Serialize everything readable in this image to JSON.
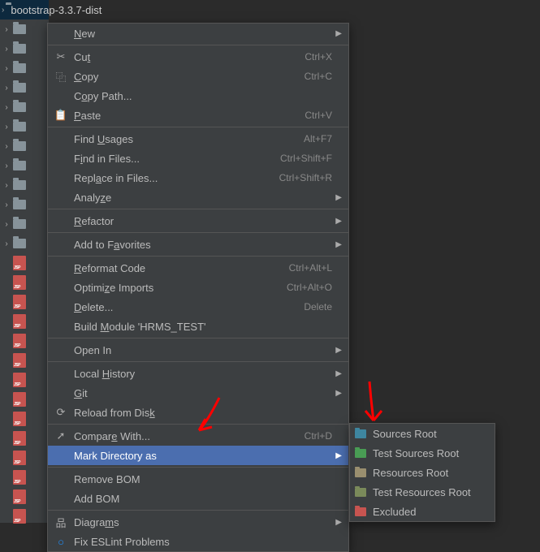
{
  "tree": {
    "selected_folder": "bootstrap-3.3.7-dist",
    "folder_rows": 12,
    "jsp_rows": 14
  },
  "context_menu": {
    "groups": [
      [
        {
          "id": "new",
          "label_html": "<span class='mn'>N</span>ew",
          "icon": "",
          "submenu": true
        }
      ],
      [
        {
          "id": "cut",
          "label_html": "Cu<span class='mn'>t</span>",
          "icon": "scissors",
          "shortcut": "Ctrl+X"
        },
        {
          "id": "copy",
          "label_html": "<span class='mn'>C</span>opy",
          "icon": "copy",
          "shortcut": "Ctrl+C"
        },
        {
          "id": "copypath",
          "label_html": "C<span class='mn'>o</span>py Path...",
          "icon": ""
        },
        {
          "id": "paste",
          "label_html": "<span class='mn'>P</span>aste",
          "icon": "clipboard",
          "shortcut": "Ctrl+V"
        }
      ],
      [
        {
          "id": "findusages",
          "label_html": "Find <span class='mn'>U</span>sages",
          "icon": "",
          "shortcut": "Alt+F7"
        },
        {
          "id": "findinfiles",
          "label_html": "F<span class='mn'>i</span>nd in Files...",
          "icon": "",
          "shortcut": "Ctrl+Shift+F"
        },
        {
          "id": "replaceinfiles",
          "label_html": "Repl<span class='mn'>a</span>ce in Files...",
          "icon": "",
          "shortcut": "Ctrl+Shift+R"
        },
        {
          "id": "analyze",
          "label_html": "Analy<span class='mn'>z</span>e",
          "icon": "",
          "submenu": true
        }
      ],
      [
        {
          "id": "refactor",
          "label_html": "<span class='mn'>R</span>efactor",
          "icon": "",
          "submenu": true
        }
      ],
      [
        {
          "id": "favorites",
          "label_html": "Add to F<span class='mn'>a</span>vorites",
          "icon": "",
          "submenu": true
        }
      ],
      [
        {
          "id": "reformat",
          "label_html": "<span class='mn'>R</span>eformat Code",
          "icon": "",
          "shortcut": "Ctrl+Alt+L"
        },
        {
          "id": "optimize",
          "label_html": "Optimi<span class='mn'>z</span>e Imports",
          "icon": "",
          "shortcut": "Ctrl+Alt+O"
        },
        {
          "id": "delete",
          "label_html": "<span class='mn'>D</span>elete...",
          "icon": "",
          "shortcut": "Delete"
        },
        {
          "id": "build",
          "label_html": "Build <span class='mn'>M</span>odule 'HRMS_TEST'",
          "icon": ""
        }
      ],
      [
        {
          "id": "openin",
          "label_html": "Open In",
          "icon": "",
          "submenu": true
        }
      ],
      [
        {
          "id": "history",
          "label_html": "Local <span class='mn'>H</span>istory",
          "icon": "",
          "submenu": true
        },
        {
          "id": "git",
          "label_html": "<span class='mn'>G</span>it",
          "icon": "",
          "submenu": true
        },
        {
          "id": "reload",
          "label_html": "Reload from Dis<span class='mn'>k</span>",
          "icon": "reload"
        }
      ],
      [
        {
          "id": "compare",
          "label_html": "Compar<span class='mn'>e</span> With...",
          "icon": "diff",
          "shortcut": "Ctrl+D"
        },
        {
          "id": "mark",
          "label_html": "Mark Directory as",
          "icon": "",
          "submenu": true,
          "highlighted": true
        }
      ],
      [
        {
          "id": "removebom",
          "label_html": "Remove BOM",
          "icon": ""
        },
        {
          "id": "addbom",
          "label_html": "Add BOM",
          "icon": ""
        }
      ],
      [
        {
          "id": "diagrams",
          "label_html": "Diagra<span class='mn'>m</span>s",
          "icon": "diagrams",
          "submenu": true
        },
        {
          "id": "eslint",
          "label_html": "Fix ESLint Problems",
          "icon": "eslint"
        }
      ]
    ]
  },
  "submenu_mark": [
    {
      "id": "sources",
      "label": "Sources Root",
      "color": "#3e86a0"
    },
    {
      "id": "tests",
      "label": "Test Sources Root",
      "color": "#499c54"
    },
    {
      "id": "resources",
      "label": "Resources Root",
      "color": "#9a8f6f"
    },
    {
      "id": "testres",
      "label": "Test Resources Root",
      "color": "#7a8a5a"
    },
    {
      "id": "excluded",
      "label": "Excluded",
      "color": "#c75450"
    }
  ],
  "icons": {
    "scissors": "✂",
    "copy": "⿻",
    "clipboard": "📋",
    "reload": "⟳",
    "diff": "➚",
    "diagrams": "品",
    "eslint": "○"
  }
}
